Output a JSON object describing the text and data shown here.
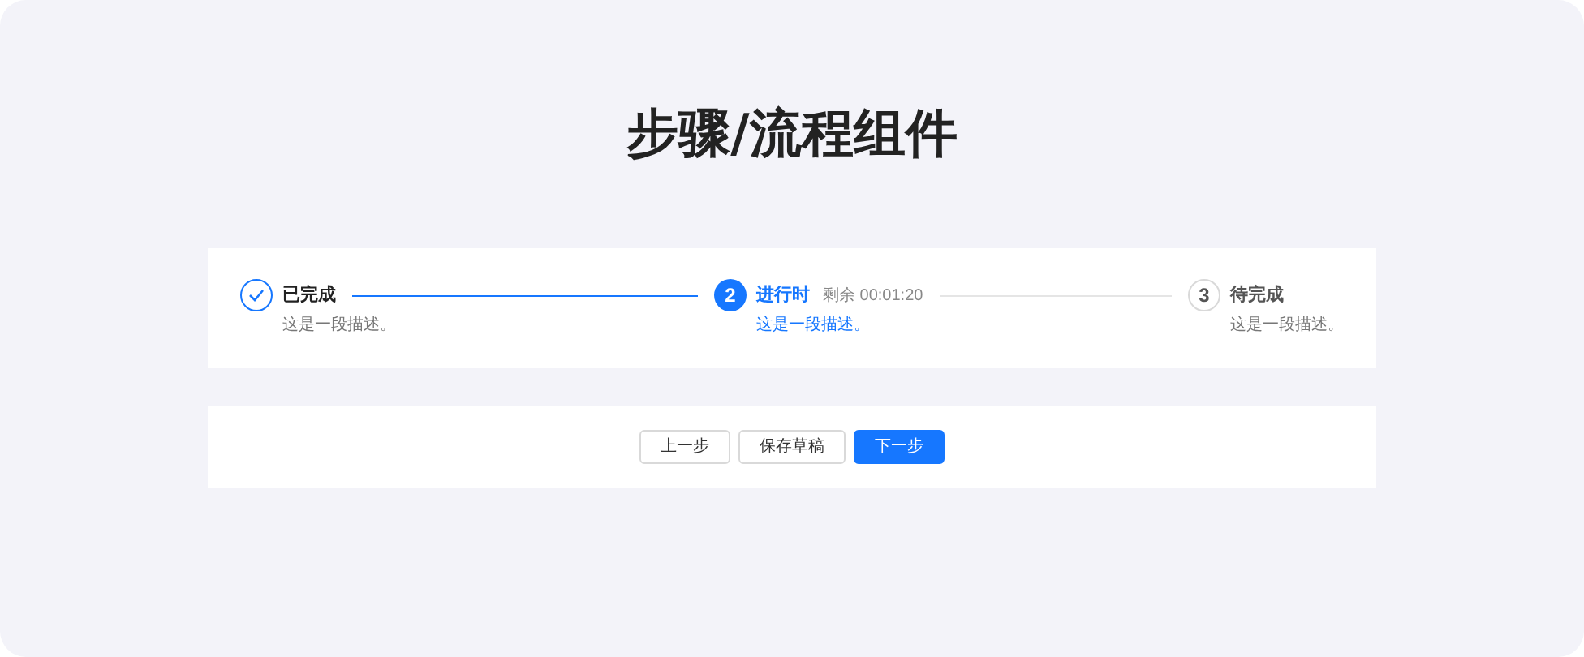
{
  "title": "步骤/流程组件",
  "steps": [
    {
      "kind": "finish",
      "title": "已完成",
      "description": "这是一段描述。"
    },
    {
      "kind": "process",
      "number": "2",
      "title": "进行时",
      "subtitle": "剩余 00:01:20",
      "description": "这是一段描述。"
    },
    {
      "kind": "wait",
      "number": "3",
      "title": "待完成",
      "description": "这是一段描述。"
    }
  ],
  "buttons": [
    {
      "label": "上一步",
      "kind": "default"
    },
    {
      "label": "保存草稿",
      "kind": "default"
    },
    {
      "label": "下一步",
      "kind": "primary"
    }
  ]
}
